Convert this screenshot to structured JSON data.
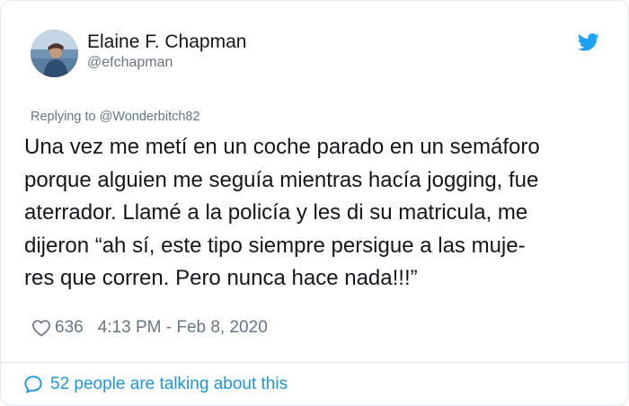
{
  "author": {
    "display_name": "Elaine F. Chapman",
    "handle": "@efchapman"
  },
  "reply_to": "Replying to @Wonderbitch82",
  "tweet_lines": [
    "Una vez me metí en un coche parado en un semáforo",
    "porque alguien me seguía mientras hacía jogging, fue",
    "aterrador. Llamé a la policía y les di su matricula, me",
    "dijeron “ah sí, este tipo siempre persigue a las muje-",
    "res que corren. Pero nunca hace nada!!!”"
  ],
  "meta": {
    "likes": "636",
    "timestamp": "4:13 PM - Feb 8, 2020"
  },
  "talking": "52 people are talking about this",
  "icons": {
    "brand": "twitter-bird-icon",
    "like": "heart-icon",
    "conversation": "speech-bubble-icon"
  },
  "colors": {
    "brand_blue": "#1da1f2",
    "link_blue": "#1b95e0",
    "secondary_text": "#657786",
    "primary_text": "#14171a",
    "border": "#e1e8ed"
  }
}
